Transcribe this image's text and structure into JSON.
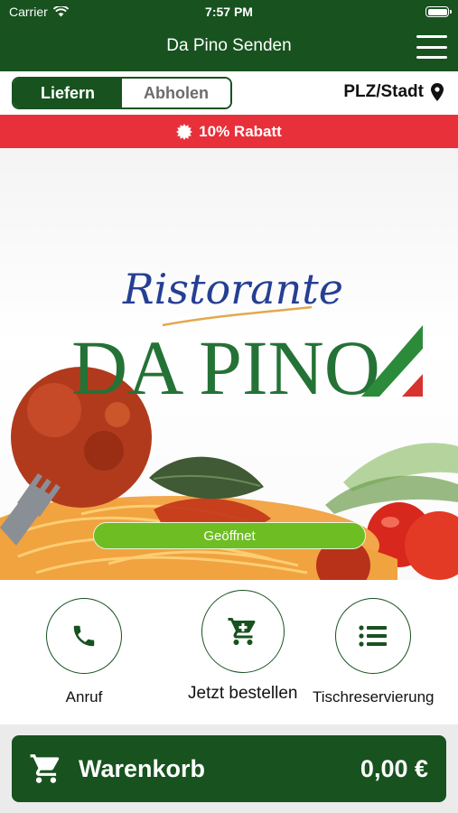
{
  "status_bar": {
    "carrier": "Carrier",
    "time": "7:57 PM"
  },
  "header": {
    "title": "Da Pino Senden"
  },
  "delivery_toggle": {
    "options": [
      "Liefern",
      "Abholen"
    ],
    "selected": "Liefern"
  },
  "location": {
    "label": "PLZ/Stadt"
  },
  "discount_banner": {
    "text": "10% Rabatt"
  },
  "hero": {
    "logo_script": "Ristorante",
    "logo_name": "DA PINO",
    "status": "Geöffnet"
  },
  "actions": [
    {
      "label": "Anruf",
      "icon": "phone-icon"
    },
    {
      "label": "Jetzt bestellen",
      "icon": "cart-icon"
    },
    {
      "label": "Tischreservierung",
      "icon": "list-icon"
    }
  ],
  "cart": {
    "label": "Warenkorb",
    "total": "0,00 €"
  },
  "colors": {
    "brand_green": "#17521f",
    "discount_red": "#e8303a",
    "open_green": "#6dbd23"
  }
}
